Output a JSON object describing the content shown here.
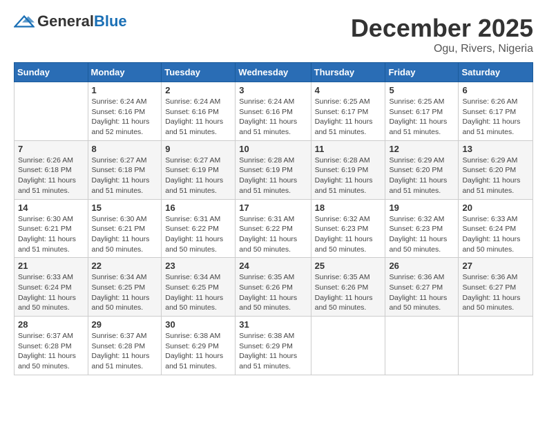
{
  "header": {
    "logo_general": "General",
    "logo_blue": "Blue",
    "main_title": "December 2025",
    "sub_title": "Ogu, Rivers, Nigeria"
  },
  "calendar": {
    "days_of_week": [
      "Sunday",
      "Monday",
      "Tuesday",
      "Wednesday",
      "Thursday",
      "Friday",
      "Saturday"
    ],
    "weeks": [
      [
        {
          "day": "",
          "info": ""
        },
        {
          "day": "1",
          "info": "Sunrise: 6:24 AM\nSunset: 6:16 PM\nDaylight: 11 hours and 52 minutes."
        },
        {
          "day": "2",
          "info": "Sunrise: 6:24 AM\nSunset: 6:16 PM\nDaylight: 11 hours and 51 minutes."
        },
        {
          "day": "3",
          "info": "Sunrise: 6:24 AM\nSunset: 6:16 PM\nDaylight: 11 hours and 51 minutes."
        },
        {
          "day": "4",
          "info": "Sunrise: 6:25 AM\nSunset: 6:17 PM\nDaylight: 11 hours and 51 minutes."
        },
        {
          "day": "5",
          "info": "Sunrise: 6:25 AM\nSunset: 6:17 PM\nDaylight: 11 hours and 51 minutes."
        },
        {
          "day": "6",
          "info": "Sunrise: 6:26 AM\nSunset: 6:17 PM\nDaylight: 11 hours and 51 minutes."
        }
      ],
      [
        {
          "day": "7",
          "info": "Sunrise: 6:26 AM\nSunset: 6:18 PM\nDaylight: 11 hours and 51 minutes."
        },
        {
          "day": "8",
          "info": "Sunrise: 6:27 AM\nSunset: 6:18 PM\nDaylight: 11 hours and 51 minutes."
        },
        {
          "day": "9",
          "info": "Sunrise: 6:27 AM\nSunset: 6:19 PM\nDaylight: 11 hours and 51 minutes."
        },
        {
          "day": "10",
          "info": "Sunrise: 6:28 AM\nSunset: 6:19 PM\nDaylight: 11 hours and 51 minutes."
        },
        {
          "day": "11",
          "info": "Sunrise: 6:28 AM\nSunset: 6:19 PM\nDaylight: 11 hours and 51 minutes."
        },
        {
          "day": "12",
          "info": "Sunrise: 6:29 AM\nSunset: 6:20 PM\nDaylight: 11 hours and 51 minutes."
        },
        {
          "day": "13",
          "info": "Sunrise: 6:29 AM\nSunset: 6:20 PM\nDaylight: 11 hours and 51 minutes."
        }
      ],
      [
        {
          "day": "14",
          "info": "Sunrise: 6:30 AM\nSunset: 6:21 PM\nDaylight: 11 hours and 51 minutes."
        },
        {
          "day": "15",
          "info": "Sunrise: 6:30 AM\nSunset: 6:21 PM\nDaylight: 11 hours and 50 minutes."
        },
        {
          "day": "16",
          "info": "Sunrise: 6:31 AM\nSunset: 6:22 PM\nDaylight: 11 hours and 50 minutes."
        },
        {
          "day": "17",
          "info": "Sunrise: 6:31 AM\nSunset: 6:22 PM\nDaylight: 11 hours and 50 minutes."
        },
        {
          "day": "18",
          "info": "Sunrise: 6:32 AM\nSunset: 6:23 PM\nDaylight: 11 hours and 50 minutes."
        },
        {
          "day": "19",
          "info": "Sunrise: 6:32 AM\nSunset: 6:23 PM\nDaylight: 11 hours and 50 minutes."
        },
        {
          "day": "20",
          "info": "Sunrise: 6:33 AM\nSunset: 6:24 PM\nDaylight: 11 hours and 50 minutes."
        }
      ],
      [
        {
          "day": "21",
          "info": "Sunrise: 6:33 AM\nSunset: 6:24 PM\nDaylight: 11 hours and 50 minutes."
        },
        {
          "day": "22",
          "info": "Sunrise: 6:34 AM\nSunset: 6:25 PM\nDaylight: 11 hours and 50 minutes."
        },
        {
          "day": "23",
          "info": "Sunrise: 6:34 AM\nSunset: 6:25 PM\nDaylight: 11 hours and 50 minutes."
        },
        {
          "day": "24",
          "info": "Sunrise: 6:35 AM\nSunset: 6:26 PM\nDaylight: 11 hours and 50 minutes."
        },
        {
          "day": "25",
          "info": "Sunrise: 6:35 AM\nSunset: 6:26 PM\nDaylight: 11 hours and 50 minutes."
        },
        {
          "day": "26",
          "info": "Sunrise: 6:36 AM\nSunset: 6:27 PM\nDaylight: 11 hours and 50 minutes."
        },
        {
          "day": "27",
          "info": "Sunrise: 6:36 AM\nSunset: 6:27 PM\nDaylight: 11 hours and 50 minutes."
        }
      ],
      [
        {
          "day": "28",
          "info": "Sunrise: 6:37 AM\nSunset: 6:28 PM\nDaylight: 11 hours and 50 minutes."
        },
        {
          "day": "29",
          "info": "Sunrise: 6:37 AM\nSunset: 6:28 PM\nDaylight: 11 hours and 51 minutes."
        },
        {
          "day": "30",
          "info": "Sunrise: 6:38 AM\nSunset: 6:29 PM\nDaylight: 11 hours and 51 minutes."
        },
        {
          "day": "31",
          "info": "Sunrise: 6:38 AM\nSunset: 6:29 PM\nDaylight: 11 hours and 51 minutes."
        },
        {
          "day": "",
          "info": ""
        },
        {
          "day": "",
          "info": ""
        },
        {
          "day": "",
          "info": ""
        }
      ]
    ]
  }
}
